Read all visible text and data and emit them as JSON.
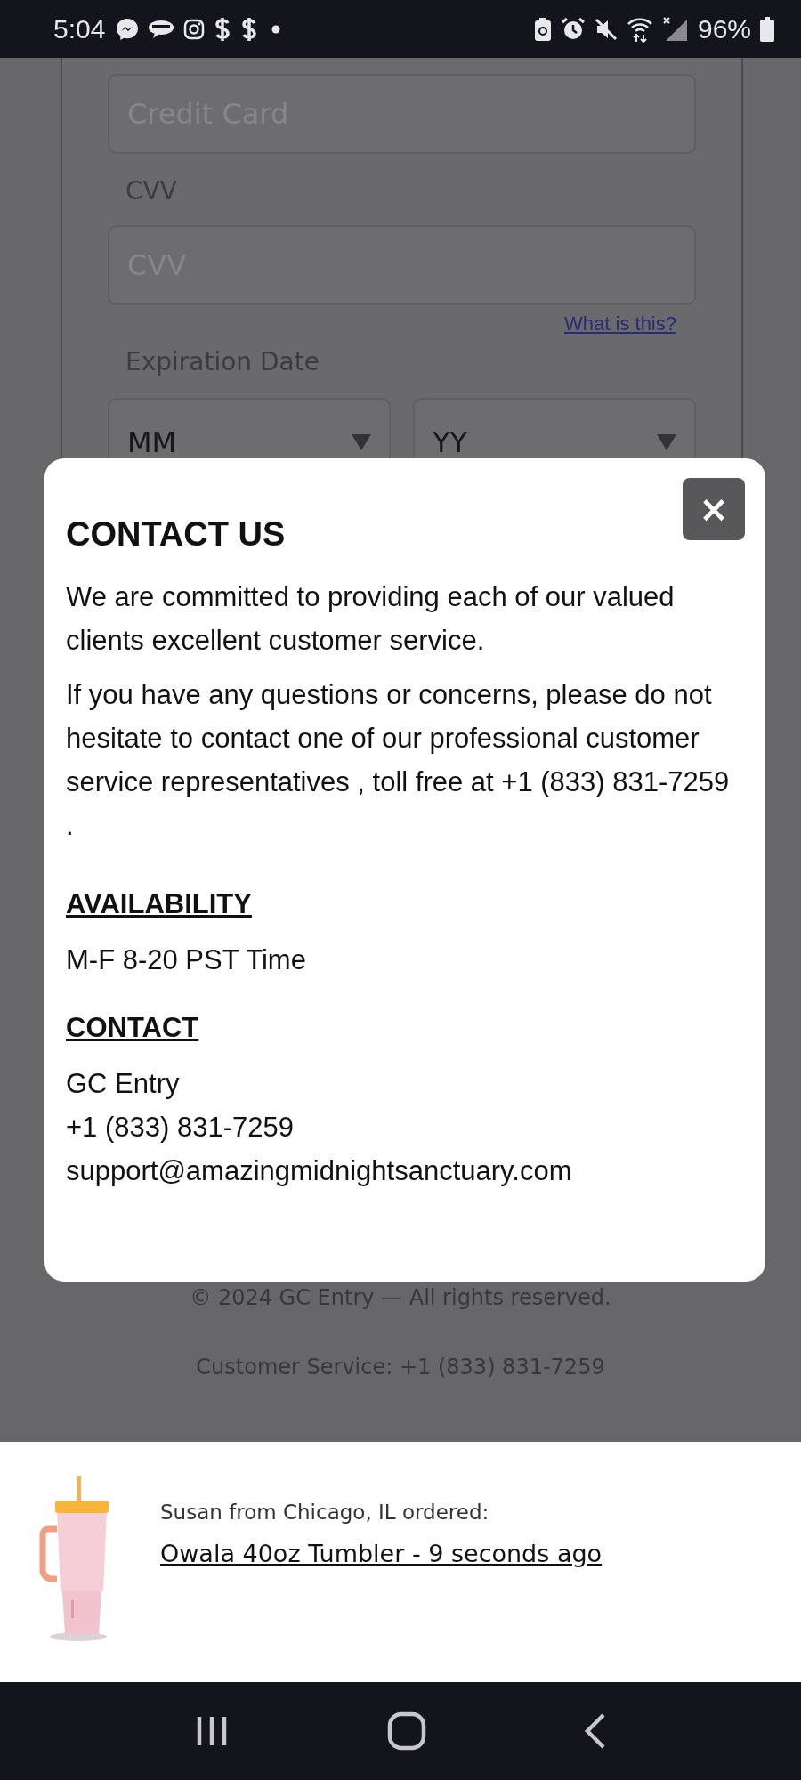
{
  "status_bar": {
    "time": "5:04",
    "battery": "96%"
  },
  "form": {
    "card_field": {
      "placeholder": "Credit Card"
    },
    "cvv_label": "CVV",
    "cvv_field": {
      "placeholder": "CVV"
    },
    "help_link": "What is this?",
    "expiration_label": "Expiration Date",
    "month_select": "MM",
    "year_select": "YY"
  },
  "modal": {
    "close": "×",
    "title": "CONTACT US",
    "paragraphs": [
      "We are committed to providing each of our valued clients excellent customer service.",
      "If you have any questions or concerns, please do not hesitate to contact one of our professional customer service representatives , toll free at +1 (833) 831-7259 ."
    ],
    "sections": [
      {
        "heading": "AVAILABILITY",
        "lines": [
          "M-F 8-20 PST Time"
        ]
      },
      {
        "heading": "CONTACT",
        "lines": [
          "GC Entry",
          "+1 (833) 831-7259",
          "support@amazingmidnightsanctuary.com"
        ]
      }
    ]
  },
  "footer": {
    "copyright": "© 2024 GC Entry — All rights reserved.",
    "customer_service": "Customer Service: +1 (833) 831-7259"
  },
  "notification": {
    "message": "Susan from Chicago, IL ordered:",
    "link": "Owala 40oz Tumbler - 9 seconds ago"
  }
}
